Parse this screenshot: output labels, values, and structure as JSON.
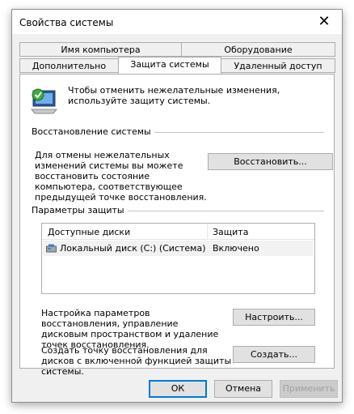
{
  "window": {
    "title": "Свойства системы",
    "close_glyph": "✕"
  },
  "tabs": {
    "row1": [
      "Имя компьютера",
      "Оборудование"
    ],
    "row2": [
      "Дополнительно",
      "Защита системы",
      "Удаленный доступ"
    ]
  },
  "info": {
    "text": "Чтобы отменить нежелательные изменения, используйте защиту системы."
  },
  "restore": {
    "heading": "Восстановление системы",
    "text": "Для отмены нежелательных изменений системы вы можете восстановить состояние компьютера, соответствующее предыдущей точке восстановления.",
    "button": "Восстановить..."
  },
  "protection": {
    "heading": "Параметры защиты",
    "columns": [
      "Доступные диски",
      "Защита"
    ],
    "rows": [
      {
        "drive": "Локальный диск (C:) (Система)",
        "status": "Включено"
      }
    ]
  },
  "configure": {
    "text": "Настройка параметров восстановления, управление дисковым пространством и удаление точек восстановления.",
    "button": "Настроить..."
  },
  "create": {
    "text": "Создать точку восстановления для дисков с включенной функцией защиты системы.",
    "button": "Создать..."
  },
  "footer": {
    "ok": "ОК",
    "cancel": "Отмена",
    "apply": "Применить"
  },
  "colors": {
    "accent": "#0078d7",
    "window_bg": "#f0f0f0",
    "panel_bg": "#ffffff",
    "selected_row": "#f2f2f2"
  }
}
